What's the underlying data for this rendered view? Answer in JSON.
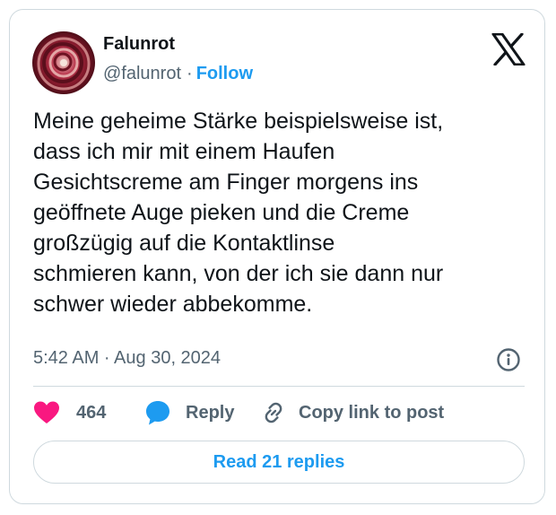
{
  "author": {
    "display_name": "Falunrot",
    "handle": "@falunrot",
    "separator": "·",
    "follow_label": "Follow"
  },
  "tweet": {
    "text": "Meine geheime Stärke beispielsweise ist,\ndass ich mir mit einem Haufen\nGesichtscreme am Finger morgens ins\ngeöffnete Auge pieken und die Creme\ngroßzügig auf die Kontaktlinse\nschmieren kann, von der ich sie dann nur\nschwer wieder abbekomme.",
    "timestamp": "5:42 AM · Aug 30, 2024"
  },
  "actions": {
    "like_count": "464",
    "reply_label": "Reply",
    "copy_link_label": "Copy link to post"
  },
  "footer": {
    "read_replies_label": "Read 21 replies"
  },
  "icons": {
    "brand": "x-logo-icon",
    "info": "info-icon",
    "like": "heart-icon",
    "reply": "speech-bubble-icon",
    "copy": "link-icon"
  },
  "colors": {
    "accent": "#1d9bf0",
    "like": "#f91880",
    "secondary_text": "#536471",
    "border": "#cfd9de"
  }
}
